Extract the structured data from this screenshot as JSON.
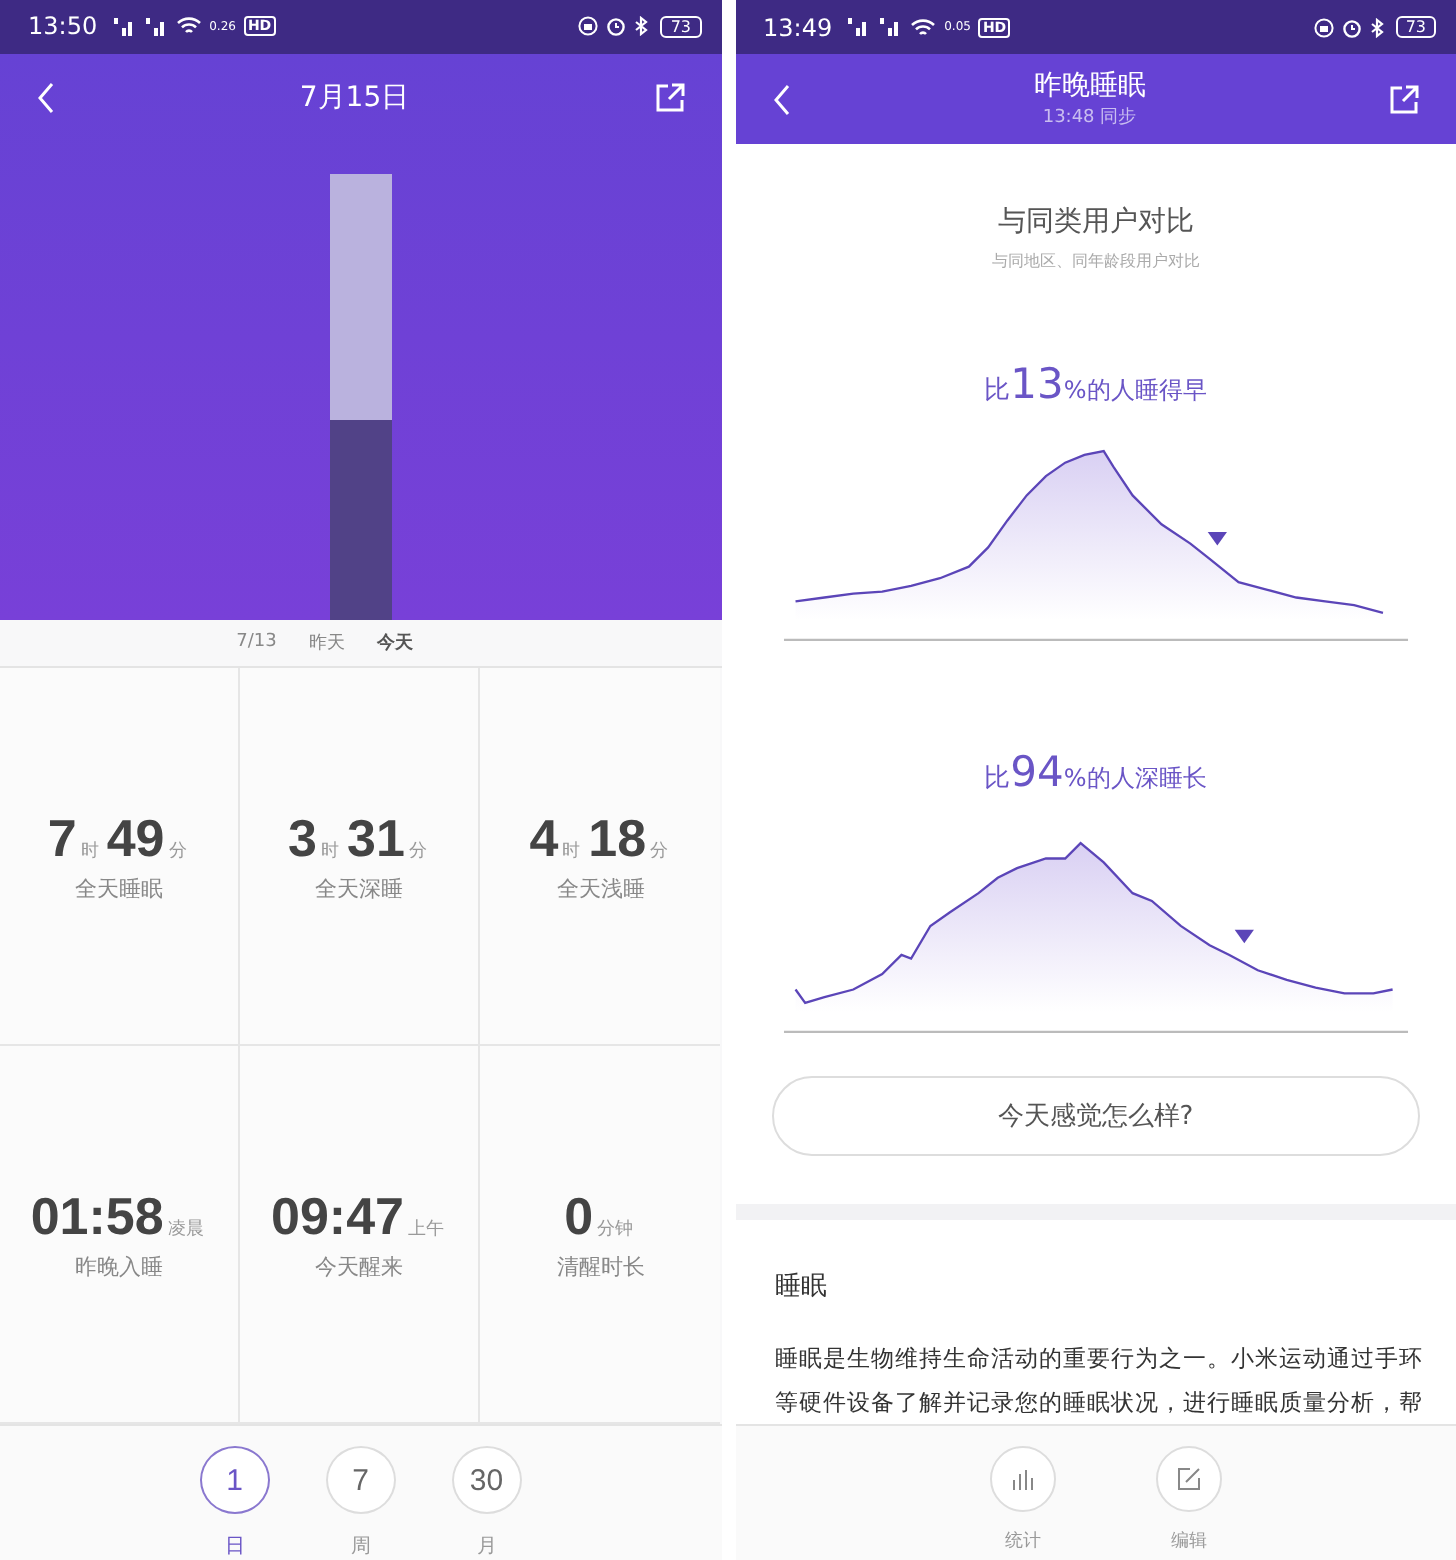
{
  "left_screen": {
    "status_bar": {
      "time": "13:50",
      "speed": "0.26",
      "hd": "HD",
      "battery": "73"
    },
    "header": {
      "title": "7月15日"
    },
    "day_axis": [
      {
        "label": "7/13",
        "selected": false
      },
      {
        "label": "昨天",
        "selected": false
      },
      {
        "label": "今天",
        "selected": true
      }
    ],
    "stats": [
      {
        "parts": [
          {
            "number": "7",
            "unit": "时"
          },
          {
            "number": "49",
            "unit": "分"
          }
        ],
        "label": "全天睡眠"
      },
      {
        "parts": [
          {
            "number": "3",
            "unit": "时"
          },
          {
            "number": "31",
            "unit": "分"
          }
        ],
        "label": "全天深睡"
      },
      {
        "parts": [
          {
            "number": "4",
            "unit": "时"
          },
          {
            "number": "18",
            "unit": "分"
          }
        ],
        "label": "全天浅睡"
      },
      {
        "parts": [
          {
            "number": "01:58",
            "unit": "凌晨"
          }
        ],
        "label": "昨晚入睡"
      },
      {
        "parts": [
          {
            "number": "09:47",
            "unit": "上午"
          }
        ],
        "label": "今天醒来"
      },
      {
        "parts": [
          {
            "number": "0",
            "unit": "分钟"
          }
        ],
        "label": "清醒时长"
      }
    ],
    "period_tabs": [
      {
        "number": "1",
        "label": "日",
        "selected": true
      },
      {
        "number": "7",
        "label": "周",
        "selected": false
      },
      {
        "number": "30",
        "label": "月",
        "selected": false
      }
    ]
  },
  "right_screen": {
    "status_bar": {
      "time": "13:49",
      "speed": "0.05",
      "hd": "HD",
      "battery": "73"
    },
    "header": {
      "title": "昨晚睡眠",
      "subtitle": "13:48 同步"
    },
    "comparison": {
      "title": "与同类用户对比",
      "subtitle": "与同地区、同年龄段用户对比"
    },
    "rankings": [
      {
        "prefix": "比",
        "percent": "13",
        "suffix": "%的人睡得早"
      },
      {
        "prefix": "比",
        "percent": "94",
        "suffix": "%的人深睡长"
      }
    ],
    "feeling_button": "今天感觉怎么样?",
    "article": {
      "heading": "睡眠",
      "text": "睡眠是生物维持生命活动的重要行为之一。小米运动通过手环等硬件设备了解并记录您的睡眠状况，进行睡眠质量分析，帮"
    },
    "bottom_actions": [
      {
        "kind": "stats",
        "label": "统计"
      },
      {
        "kind": "edit",
        "label": "编辑"
      }
    ]
  }
}
